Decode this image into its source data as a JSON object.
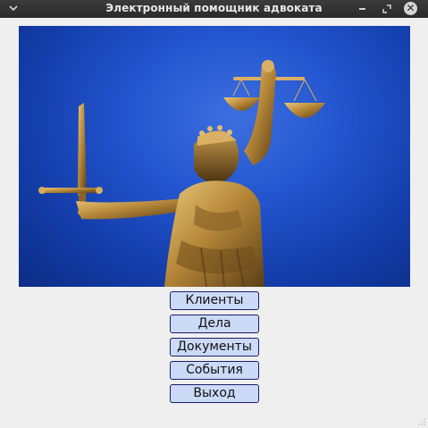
{
  "window": {
    "title": "Электронный помощник адвоката"
  },
  "titlebar_icons": [
    "chevron-down-icon",
    "minimize-icon",
    "restore-icon",
    "close-icon"
  ],
  "hero_image": {
    "subject": "lady-justice-statue",
    "background_color": "#1f4fc8"
  },
  "menu": {
    "buttons": [
      {
        "id": "clients",
        "label": "Клиенты"
      },
      {
        "id": "cases",
        "label": "Дела"
      },
      {
        "id": "documents",
        "label": "Документы"
      },
      {
        "id": "events",
        "label": "События"
      },
      {
        "id": "exit",
        "label": "Выход"
      }
    ]
  },
  "colors": {
    "button_fill": "#cbdaf7",
    "button_border": "#1c1c6a",
    "titlebar": "#2f2f2f",
    "window_bg": "#efefef"
  }
}
